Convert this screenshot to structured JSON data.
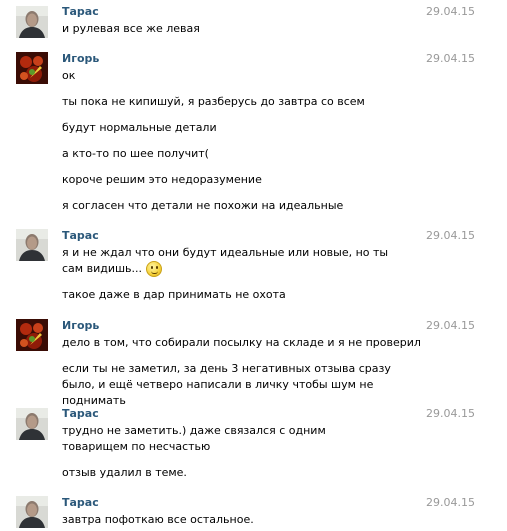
{
  "messages": [
    {
      "author": "Тарас",
      "avatar": "taras-avatar",
      "date": "29.04.15",
      "lines": [
        "и рулевая все же левая"
      ]
    },
    {
      "author": "Игорь",
      "avatar": "igor-avatar",
      "date": "29.04.15",
      "lines": [
        "ок",
        "ты пока не кипишуй, я разберусь до завтра со всем",
        "будут нормальные детали",
        "а кто-то по шее получит(",
        "короче решим это недоразумение",
        "я согласен что детали не похожи на идеальные"
      ]
    },
    {
      "author": "Тарас",
      "avatar": "taras-avatar",
      "date": "29.04.15",
      "lines": [
        "я и не ждал что они будут идеальные или новые, но ты сам видишь...",
        "такое даже в дар принимать не охота"
      ],
      "emoji": "smile-emoji"
    },
    {
      "author": "Игорь",
      "avatar": "igor-avatar",
      "date": "29.04.15",
      "lines": [
        "дело в том, что собирали посылку на складе и я не проверил",
        "если ты не заметил, за день 3 негативных отзыва сразу было, и ещё четверо написали в личку чтобы шум не поднимать"
      ]
    },
    {
      "author": "Тарас",
      "avatar": "taras-avatar",
      "date": "29.04.15",
      "lines": [
        "трудно не заметить.) даже связался с одним товарищем по несчастью",
        "отзыв удалил в теме."
      ]
    },
    {
      "author": "Тарас",
      "avatar": "taras-avatar",
      "date": "29.04.15",
      "lines": [
        "завтра пофоткаю все остальное."
      ]
    }
  ]
}
